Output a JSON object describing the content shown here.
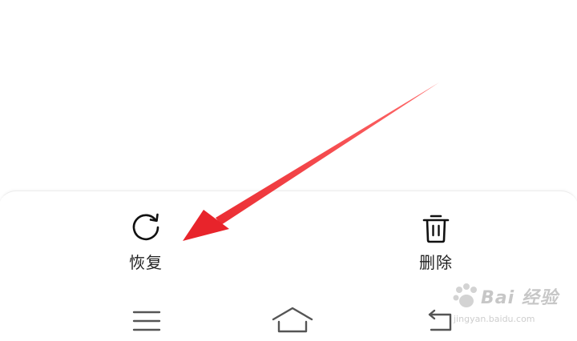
{
  "bottom_actions": {
    "restore_label": "恢复",
    "delete_label": "删除"
  },
  "icons": {
    "restore": "refresh-icon",
    "delete": "trash-icon",
    "nav_menu": "menu-icon",
    "nav_home": "home-icon",
    "nav_back": "back-icon"
  },
  "annotation_arrow": {
    "color": "#e8242b",
    "points_to": "restore"
  },
  "watermark": {
    "brand": "Bai 经验",
    "url": "jingyan.baidu.com"
  }
}
